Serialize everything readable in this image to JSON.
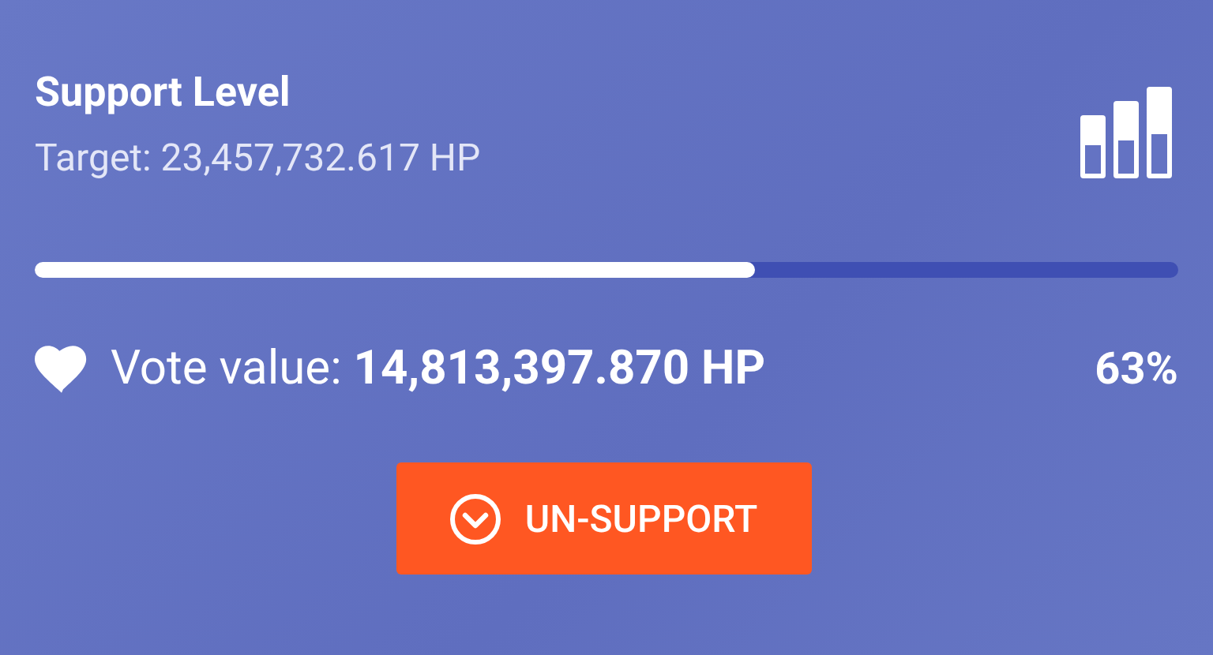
{
  "card": {
    "title": "Support Level",
    "target": "Target: 23,457,732.617 HP"
  },
  "progress": {
    "level": 0.63
  },
  "vote": {
    "text": "Vote value: **14,813,397.870 HP**",
    "percent": "63%"
  },
  "button": {
    "label": "UN-SUPPORT"
  }
}
